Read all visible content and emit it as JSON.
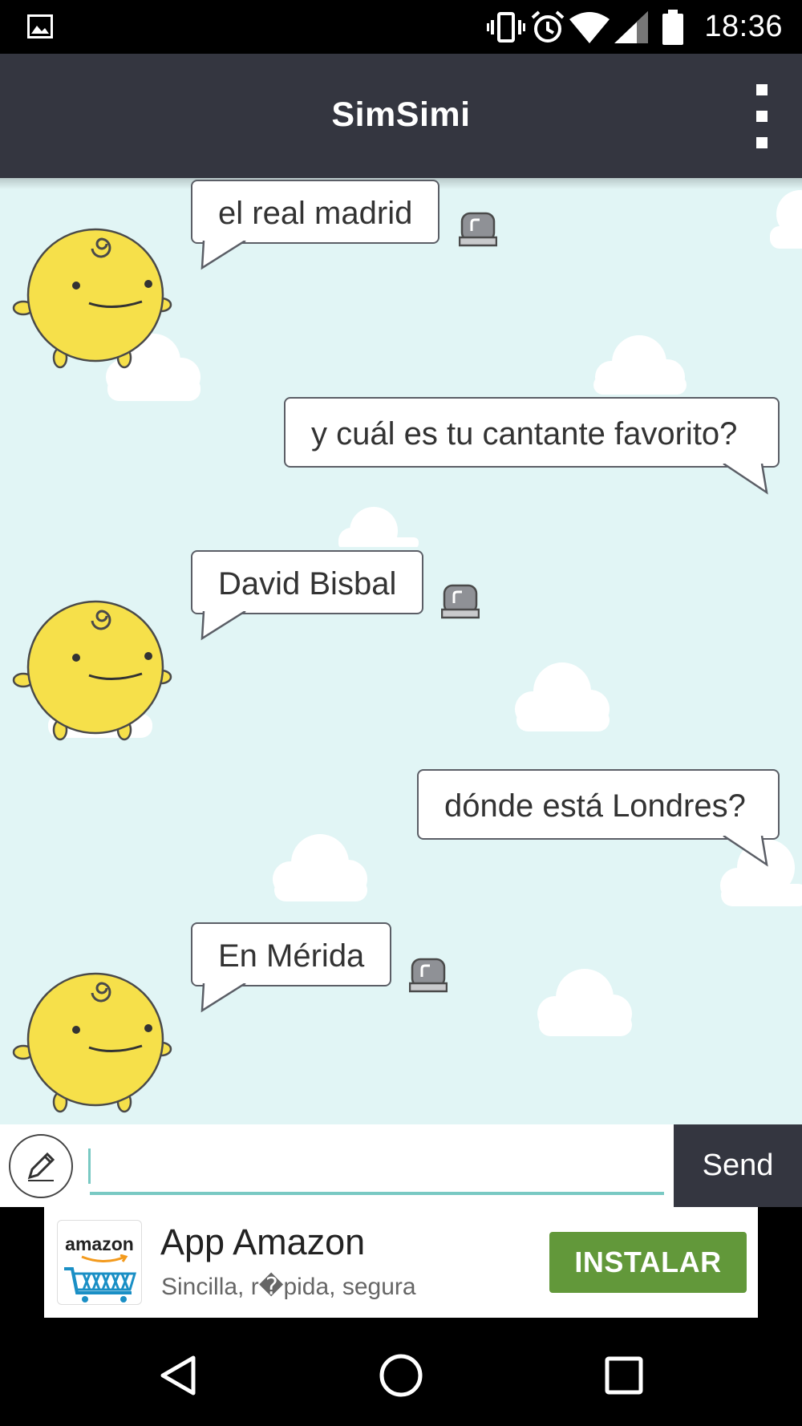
{
  "status_bar": {
    "time": "18:36",
    "icons": [
      "gallery-icon",
      "vibrate-icon",
      "alarm-icon",
      "wifi-icon",
      "signal-icon",
      "battery-icon"
    ]
  },
  "app_bar": {
    "title": "SimSimi",
    "menu_icon": "more-vert-icon"
  },
  "chat": {
    "messages": [
      {
        "sender": "bot",
        "text": "el real madrid"
      },
      {
        "sender": "user",
        "text": "y cuál es tu cantante favorito?"
      },
      {
        "sender": "bot",
        "text": "David Bisbal"
      },
      {
        "sender": "user",
        "text": "dónde está Londres?"
      },
      {
        "sender": "bot",
        "text": "En Mérida"
      }
    ],
    "background_color": "#e1f5f5",
    "avatar_color": "#f6e04a"
  },
  "input_bar": {
    "value": "",
    "send_label": "Send"
  },
  "ad": {
    "logo_text": "amazon",
    "title": "App Amazon",
    "subtitle": "Sincilla, r�pida, segura",
    "cta": "INSTALAR",
    "cta_color": "#62983a"
  },
  "nav_bar": {
    "buttons": [
      "back-icon",
      "home-icon",
      "recents-icon"
    ]
  }
}
